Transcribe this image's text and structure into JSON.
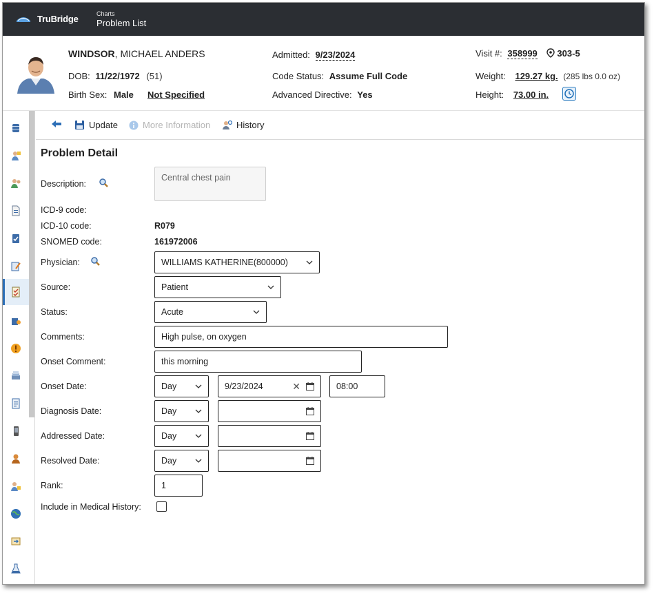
{
  "app": {
    "brand": "TruBridge",
    "crumb_small": "Charts",
    "crumb_title": "Problem List"
  },
  "patient": {
    "last_name": "WINDSOR",
    "first_names": ", MICHAEL ANDERS",
    "dob_label": "DOB:",
    "dob": "11/22/1972",
    "age": "(51)",
    "birth_sex_label": "Birth Sex:",
    "birth_sex": "Male",
    "gender_identity": "Not Specified",
    "admitted_label": "Admitted:",
    "admitted": "9/23/2024",
    "code_status_label": "Code Status:",
    "code_status": "Assume Full Code",
    "adv_directive_label": "Advanced Directive:",
    "adv_directive": "Yes",
    "visit_label": "Visit #:",
    "visit": "358999",
    "room": "303-5",
    "weight_label": "Weight:",
    "weight": "129.27 kg.",
    "weight_alt": "(285 lbs 0.0 oz)",
    "height_label": "Height:",
    "height": "73.00 in."
  },
  "toolbar": {
    "update": "Update",
    "more_info": "More Information",
    "history": "History"
  },
  "form": {
    "title": "Problem Detail",
    "description_label": "Description:",
    "description_value": "Central chest pain",
    "icd9_label": "ICD-9 code:",
    "icd10_label": "ICD-10 code:",
    "icd10_value": "R079",
    "snomed_label": "SNOMED code:",
    "snomed_value": "161972006",
    "physician_label": "Physician:",
    "physician_value": "WILLIAMS KATHERINE(800000)",
    "source_label": "Source:",
    "source_value": "Patient",
    "status_label": "Status:",
    "status_value": "Acute",
    "comments_label": "Comments:",
    "comments_value": "High pulse, on oxygen",
    "onset_comment_label": "Onset Comment:",
    "onset_comment_value": "this morning",
    "onset_date_label": "Onset Date:",
    "onset_precision": "Day",
    "onset_date": "9/23/2024",
    "onset_time": "08:00",
    "diagnosis_date_label": "Diagnosis Date:",
    "diagnosis_precision": "Day",
    "addressed_date_label": "Addressed Date:",
    "addressed_precision": "Day",
    "resolved_date_label": "Resolved Date:",
    "resolved_precision": "Day",
    "rank_label": "Rank:",
    "rank_value": "1",
    "include_history_label": "Include in Medical History:"
  },
  "colors": {
    "topbar": "#2b2e33",
    "accent": "#2d6fb7"
  }
}
